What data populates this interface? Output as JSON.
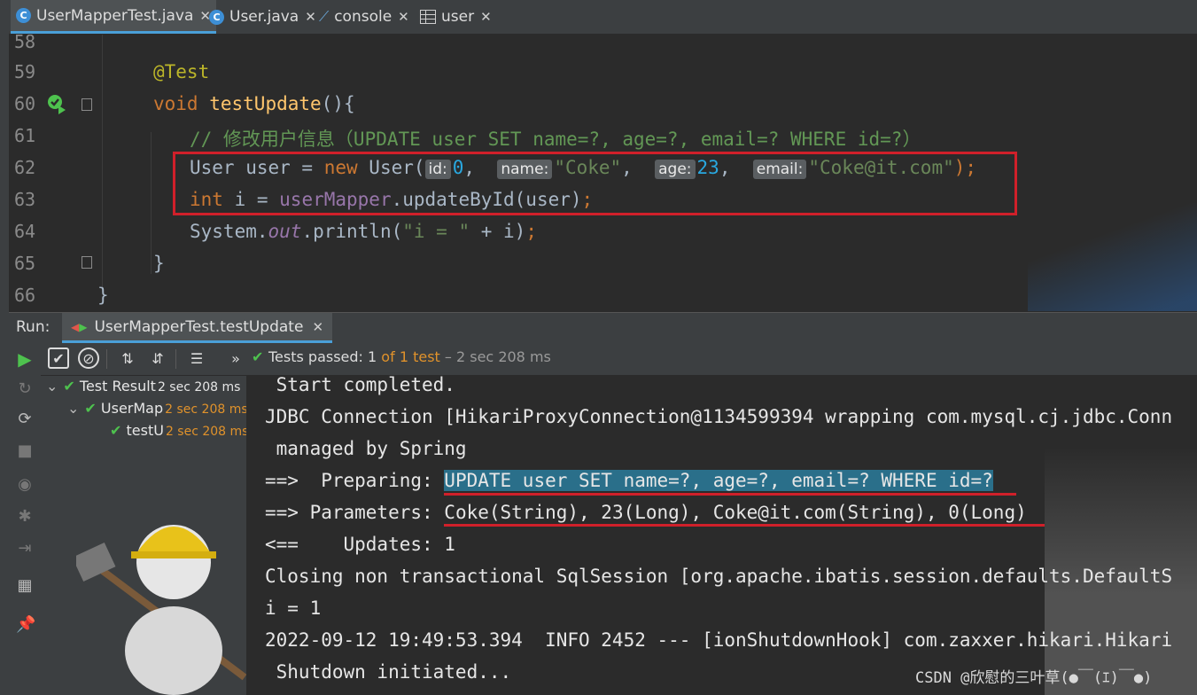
{
  "tabs": [
    {
      "label": "UserMapperTest.java",
      "icon": "java-class-icon",
      "active": true
    },
    {
      "label": "User.java",
      "icon": "java-class-icon",
      "active": false
    },
    {
      "label": "console",
      "icon": "sql-console-icon",
      "active": false
    },
    {
      "label": "user",
      "icon": "table-icon",
      "active": false
    }
  ],
  "editor": {
    "line_numbers": [
      "58",
      "59",
      "60",
      "61",
      "62",
      "63",
      "64",
      "65",
      "66"
    ],
    "annotation": "@Test",
    "kw_void": "void",
    "method_name": "testUpdate",
    "method_tail": "(){",
    "comment": "// 修改用户信息（UPDATE user SET name=?, age=?, email=? WHERE id=?）",
    "l62": {
      "decl": "User user = ",
      "kw_new": "new",
      "ctor": " User(",
      "hint_id": "id:",
      "val_id": "0",
      "comma1": ",  ",
      "hint_name": "name:",
      "val_name": "\"Coke\"",
      "comma2": ",  ",
      "hint_age": "age:",
      "val_age": "23",
      "comma3": ",  ",
      "hint_email": "email:",
      "val_email": "\"Coke@it.com\"",
      "tail": ");"
    },
    "l63": {
      "kw_int": "int",
      "mid": " i = ",
      "field": "userMapper",
      "call": ".updateById(user)",
      "semi": ";"
    },
    "l64": {
      "sys": "System.",
      "out": "out",
      "call": ".println(",
      "str": "\"i = \"",
      "tail": " + i)",
      "semi": ";"
    },
    "close_inner": "}",
    "close_outer": "}"
  },
  "run": {
    "label": "Run:",
    "tab_label": "UserMapperTest.testUpdate"
  },
  "status": {
    "prefix": "Tests passed: ",
    "passed": "1",
    "of": " of ",
    "total": "1 test",
    "time": " – 2 sec 208 ms"
  },
  "tree": [
    {
      "label": "Test Result",
      "time": "2 sec 208 ms"
    },
    {
      "label": "UserMap",
      "time": "2 sec 208 ms"
    },
    {
      "label": "testU",
      "time": "2 sec 208 ms"
    }
  ],
  "console": [
    " Start completed.",
    "JDBC Connection [HikariProxyConnection@1134599394 wrapping com.mysql.cj.jdbc.Conn",
    " managed by Spring",
    "==>  Preparing: ",
    "UPDATE user SET name=?, age=?, email=? WHERE id=?",
    "==> Parameters: ",
    "Coke(String), 23(Long), Coke@it.com(String), 0(Long)",
    "<==    Updates: 1",
    "Closing non transactional SqlSession [org.apache.ibatis.session.defaults.DefaultS",
    "i = 1",
    "2022-09-12 19:49:53.394  INFO 2452 --- [ionShutdownHook] com.zaxxer.hikari.Hikari",
    " Shutdown initiated..."
  ],
  "watermark": "CSDN @欣慰的三叶草(●￣(ｴ)￣●)",
  "colors": {
    "accent": "#4a9fd8",
    "passed": "#4ec24e",
    "highlight_box": "#d0202a"
  }
}
